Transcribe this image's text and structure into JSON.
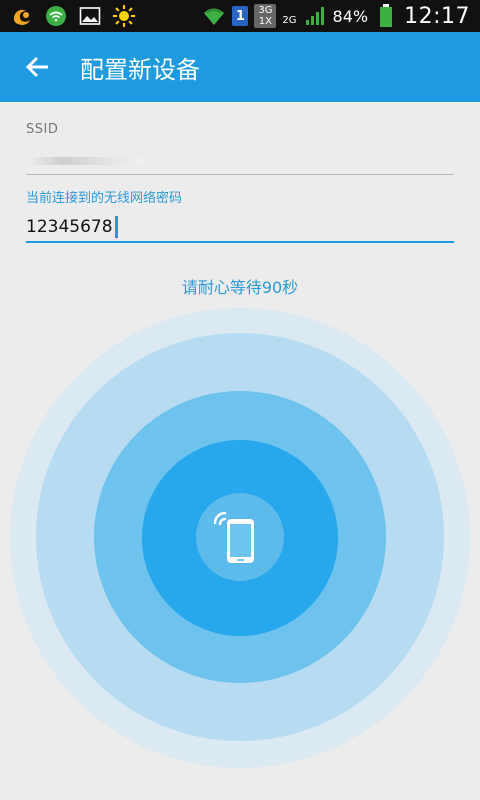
{
  "status_bar": {
    "sim_slot": "1",
    "network_top": "3G",
    "network_bottom": "1X",
    "network_2g": "2G",
    "battery_percent": "84%",
    "time": "12:17",
    "icons": [
      "uc-browser-icon",
      "wifi-notification-icon",
      "gallery-icon",
      "weather-sun-icon",
      "wifi-signal-icon",
      "cell-signal-icon",
      "battery-icon"
    ]
  },
  "app_bar": {
    "title": "配置新设备",
    "back_icon": "back-arrow-icon"
  },
  "form": {
    "ssid_label": "SSID",
    "password_label": "当前连接到的无线网络密码",
    "password_value": "12345678"
  },
  "wait_message": "请耐心等待90秒",
  "colors": {
    "accent": "#1e9ae0",
    "label_blue": "#2a9ad8"
  }
}
